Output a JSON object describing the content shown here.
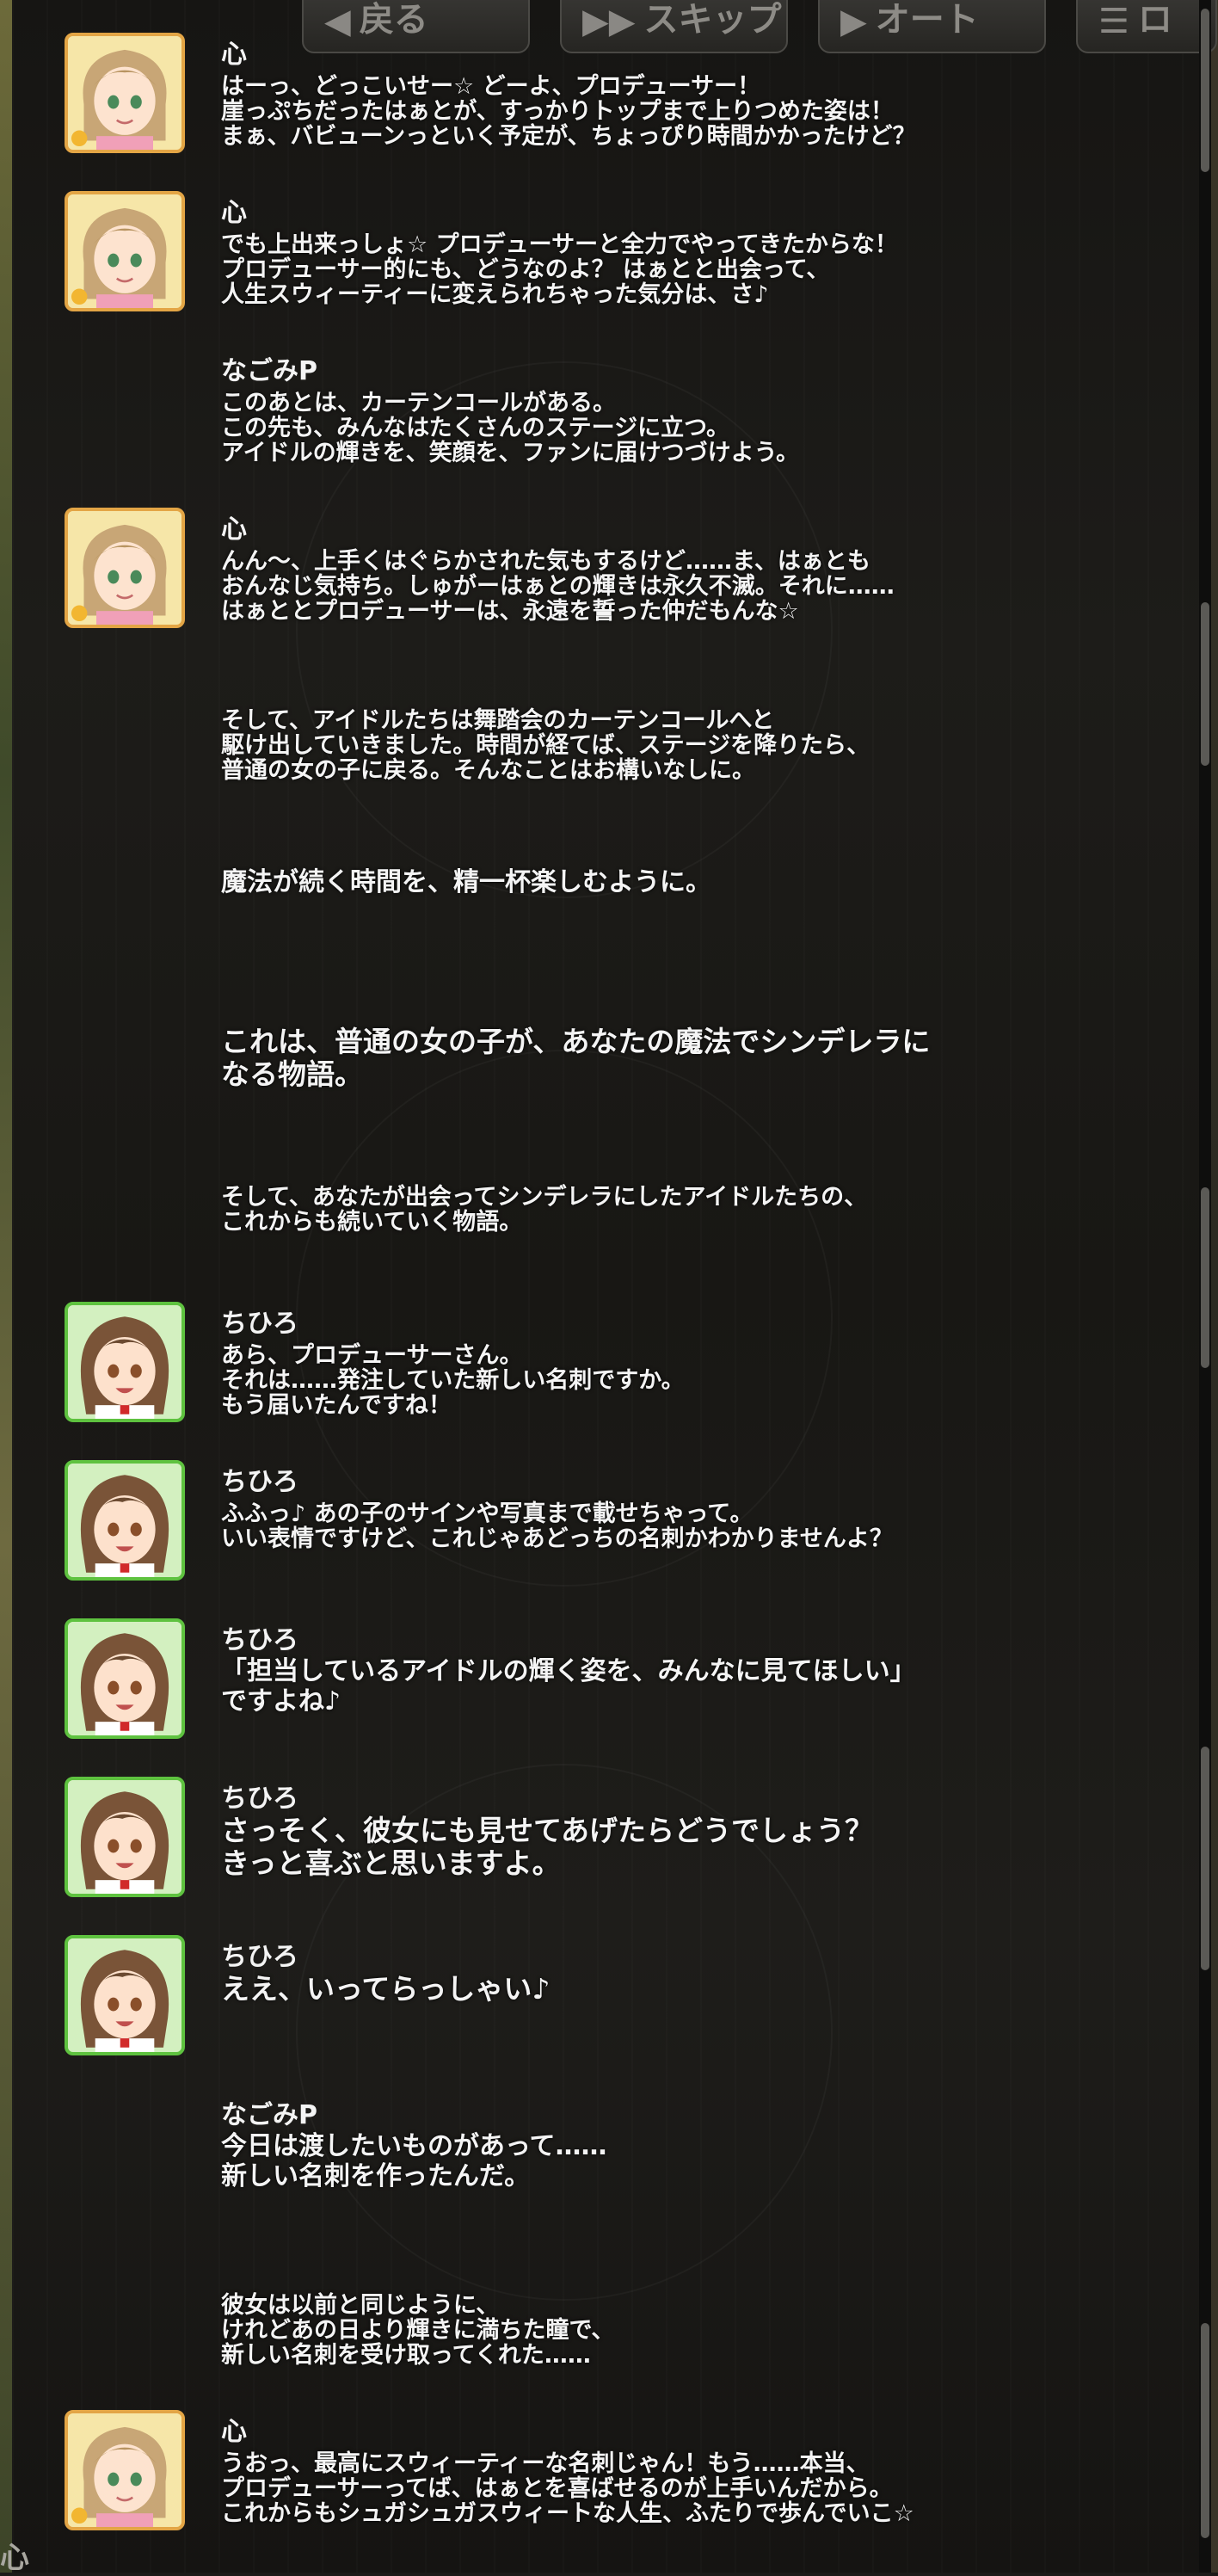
{
  "toolbar": {
    "back_label": "戻る",
    "skip_label": "スキップ",
    "auto_label": "オート",
    "log_label": "ロ"
  },
  "corner_char": "心",
  "log": [
    {
      "speaker": "心",
      "avatar": "kokoro",
      "lines": [
        "はーっ、どっこいせー☆ どーよ、プロデューサー！",
        "崖っぷちだったはぁとが、すっかりトップまで上りつめた姿は！",
        "まぁ、バビューンっといく予定が、ちょっぴり時間かかったけど？"
      ]
    },
    {
      "speaker": "心",
      "avatar": "kokoro",
      "lines": [
        "でも上出来っしょ☆ プロデューサーと全力でやってきたからな！",
        "プロデューサー的にも、どうなのよ？ はぁとと出会って、",
        "人生スウィーティーに変えられちゃった気分は、さ♪"
      ]
    },
    {
      "speaker": "なごみP",
      "avatar": "",
      "lines": [
        "このあとは、カーテンコールがある。",
        "この先も、みんなはたくさんのステージに立つ。",
        "アイドルの輝きを、笑顔を、ファンに届けつづけよう。"
      ]
    },
    {
      "speaker": "心",
      "avatar": "kokoro",
      "lines": [
        "んん～、上手くはぐらかされた気もするけど……ま、はぁとも",
        "おんなじ気持ち。しゅがーはぁとの輝きは永久不滅。それに……",
        "はぁととプロデューサーは、永遠を誓った仲だもんな☆"
      ]
    },
    {
      "speaker": "",
      "avatar": "",
      "lines": [
        "そして、アイドルたちは舞踏会のカーテンコールへと",
        "駆け出していきました。時間が経てば、ステージを降りたら、",
        "普通の女の子に戻る。そんなことはお構いなしに。"
      ]
    },
    {
      "speaker": "",
      "avatar": "",
      "lines": [
        "魔法が続く時間を、精一杯楽しむように。"
      ]
    },
    {
      "speaker": "",
      "avatar": "",
      "lines": [
        "これは、普通の女の子が、あなたの魔法でシンデレラに",
        "なる物語。"
      ]
    },
    {
      "speaker": "",
      "avatar": "",
      "lines": [
        "そして、あなたが出会ってシンデレラにしたアイドルたちの、",
        "これからも続いていく物語。"
      ]
    },
    {
      "speaker": "ちひろ",
      "avatar": "chihiro",
      "lines": [
        "あら、プロデューサーさん。",
        "それは……発注していた新しい名刺ですか。",
        "もう届いたんですね！"
      ]
    },
    {
      "speaker": "ちひろ",
      "avatar": "chihiro",
      "lines": [
        "ふふっ♪ あの子のサインや写真まで載せちゃって。",
        "いい表情ですけど、これじゃあどっちの名刺かわかりませんよ？"
      ]
    },
    {
      "speaker": "ちひろ",
      "avatar": "chihiro",
      "lines": [
        "「担当しているアイドルの輝く姿を、みんなに見てほしい」",
        "ですよね♪"
      ]
    },
    {
      "speaker": "ちひろ",
      "avatar": "chihiro",
      "lines": [
        "さっそく、彼女にも見せてあげたらどうでしょう？",
        "きっと喜ぶと思いますよ。"
      ]
    },
    {
      "speaker": "ちひろ",
      "avatar": "chihiro",
      "lines": [
        "ええ、いってらっしゃい♪"
      ]
    },
    {
      "speaker": "なごみP",
      "avatar": "",
      "lines": [
        "今日は渡したいものがあって……",
        "新しい名刺を作ったんだ。"
      ]
    },
    {
      "speaker": "",
      "avatar": "",
      "lines": [
        "彼女は以前と同じように、",
        "けれどあの日より輝きに満ちた瞳で、",
        "新しい名刺を受け取ってくれた……"
      ]
    },
    {
      "speaker": "心",
      "avatar": "kokoro",
      "lines": [
        "うおっ、最高にスウィーティーな名刺じゃん！もう……本当、",
        "プロデューサーってば、はぁとを喜ばせるのが上手いんだから。",
        "これからもシュガシュガスウィートな人生、ふたりで歩んでいこ☆"
      ]
    }
  ]
}
